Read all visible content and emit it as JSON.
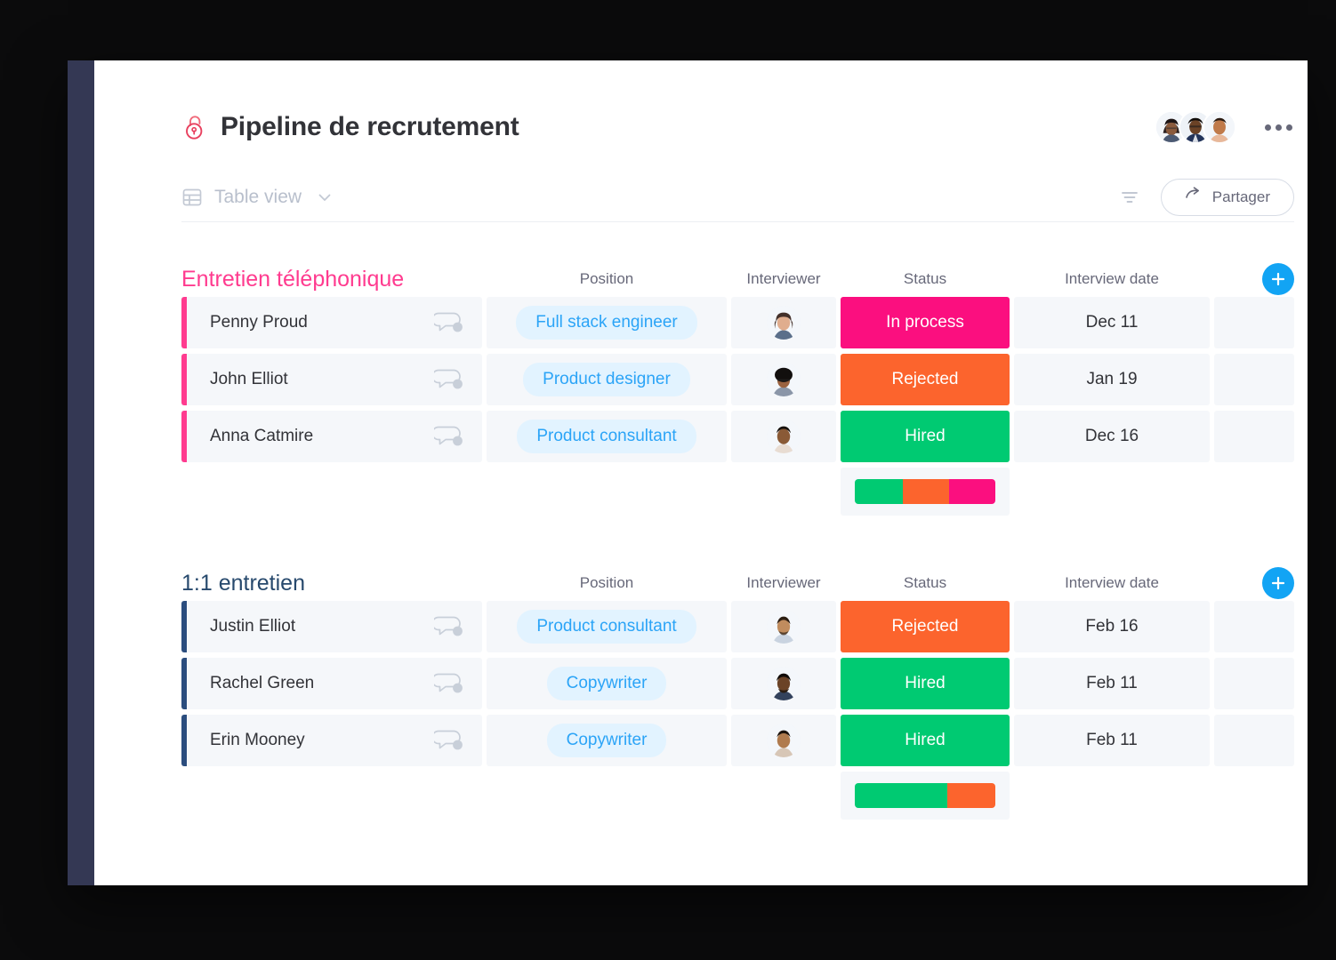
{
  "header": {
    "title": "Pipeline de recrutement",
    "lock_icon": "lock-icon",
    "menu_icon": "more-options-icon",
    "avatars": [
      {
        "name": "collaborator-avatar-1"
      },
      {
        "name": "collaborator-avatar-2"
      },
      {
        "name": "collaborator-avatar-3"
      }
    ]
  },
  "viewbar": {
    "table_icon": "table-icon",
    "view_label": "Table view",
    "chevron_icon": "chevron-down-icon",
    "filter_icon": "filter-icon",
    "share_icon": "share-arrow-icon",
    "share_label": "Partager"
  },
  "columns": {
    "position": "Position",
    "interviewer": "Interviewer",
    "status": "Status",
    "date": "Interview date"
  },
  "colors": {
    "accent_blue": "#12a4f4",
    "pink": "#ff3b8f",
    "status_pink": "#fb0f7f",
    "status_orange": "#fc642d",
    "status_green": "#00ca72",
    "navy": "#27496d",
    "group1_bar": "#ff3b8f",
    "group2_bar": "#2b4d7e",
    "pill_bg": "#e2f3ff",
    "pill_text": "#2ba4f7",
    "cell_bg": "#f5f7fa",
    "rail": "#343854"
  },
  "add_button_label": "+",
  "groups": [
    {
      "name": "Entretien téléphonique",
      "color_class": "pink",
      "rows": [
        {
          "name": "Penny Proud",
          "position": "Full stack engineer",
          "status": "In process",
          "status_color": "#fb0f7f",
          "date": "Dec 11"
        },
        {
          "name": "John Elliot",
          "position": "Product designer",
          "status": "Rejected",
          "status_color": "#fc642d",
          "date": "Jan 19"
        },
        {
          "name": "Anna Catmire",
          "position": "Product consultant",
          "status": "Hired",
          "status_color": "#00ca72",
          "date": "Dec 16"
        }
      ],
      "status_summary": [
        {
          "label": "Hired",
          "color": "#00ca72",
          "percent": 34
        },
        {
          "label": "Rejected",
          "color": "#fc642d",
          "percent": 33
        },
        {
          "label": "In process",
          "color": "#fb0f7f",
          "percent": 33
        }
      ]
    },
    {
      "name": "1:1 entretien",
      "color_class": "navy",
      "rows": [
        {
          "name": "Justin Elliot",
          "position": "Product consultant",
          "status": "Rejected",
          "status_color": "#fc642d",
          "date": "Feb 16"
        },
        {
          "name": "Rachel Green",
          "position": "Copywriter",
          "status": "Hired",
          "status_color": "#00ca72",
          "date": "Feb 11"
        },
        {
          "name": "Erin Mooney",
          "position": "Copywriter",
          "status": "Hired",
          "status_color": "#00ca72",
          "date": "Feb 11"
        }
      ],
      "status_summary": [
        {
          "label": "Hired",
          "color": "#00ca72",
          "percent": 66
        },
        {
          "label": "Rejected",
          "color": "#fc642d",
          "percent": 34
        }
      ]
    }
  ]
}
